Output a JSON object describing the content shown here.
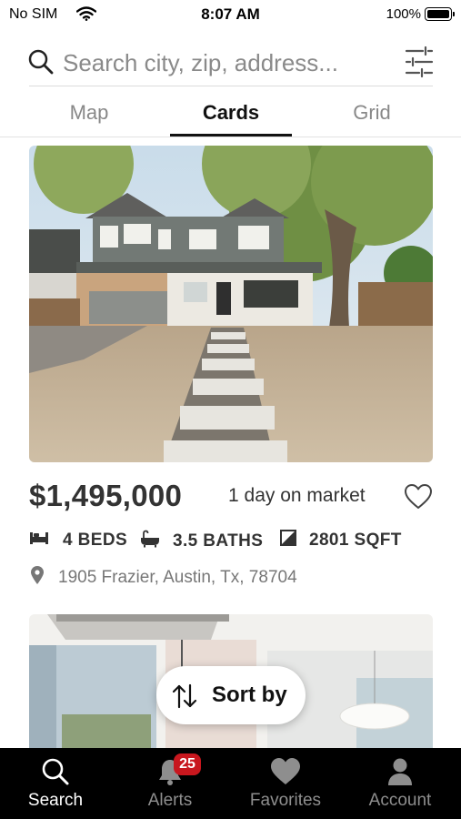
{
  "status_bar": {
    "carrier": "No SIM",
    "time": "8:07 AM",
    "battery": "100%"
  },
  "search": {
    "placeholder": "Search city, zip, address..."
  },
  "tabs": [
    {
      "label": "Map",
      "active": false
    },
    {
      "label": "Cards",
      "active": true
    },
    {
      "label": "Grid",
      "active": false
    }
  ],
  "listing": {
    "price": "$1,495,000",
    "market_status": "1 day on market",
    "beds": "4 BEDS",
    "baths": "3.5 BATHS",
    "sqft": "2801 SQFT",
    "address": "1905 Frazier, Austin, Tx, 78704"
  },
  "sort": {
    "label": "Sort by"
  },
  "bottom_nav": {
    "items": [
      {
        "label": "Search",
        "icon": "search-icon",
        "active": true
      },
      {
        "label": "Alerts",
        "icon": "bell-icon",
        "active": false
      },
      {
        "label": "Favorites",
        "icon": "heart-icon",
        "active": false
      },
      {
        "label": "Account",
        "icon": "person-icon",
        "active": false
      }
    ],
    "alerts_badge": "25"
  },
  "colors": {
    "accent": "#111111",
    "badge": "#c8171e",
    "nav_bg": "#000000"
  }
}
